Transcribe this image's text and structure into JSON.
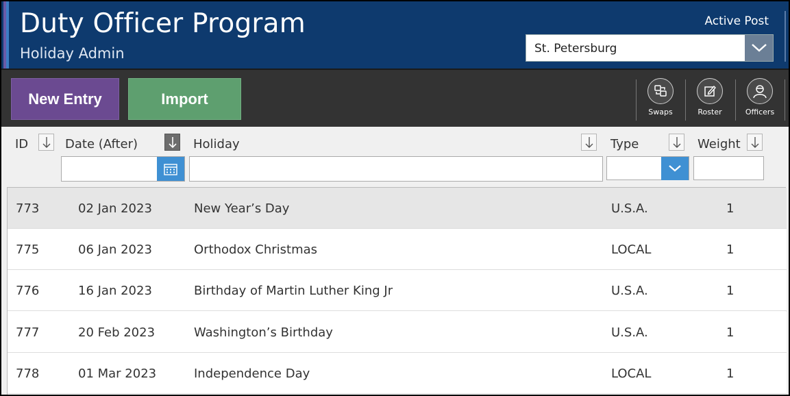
{
  "header": {
    "title": "Duty Officer Program",
    "subtitle": "Holiday Admin",
    "active_post_label": "Active Post",
    "active_post_value": "St. Petersburg"
  },
  "toolbar": {
    "new_entry_label": "New Entry",
    "import_label": "Import",
    "nav": [
      {
        "label": "Swaps",
        "icon": "swap-icon"
      },
      {
        "label": "Roster",
        "icon": "edit-icon"
      },
      {
        "label": "Officers",
        "icon": "officer-icon"
      }
    ]
  },
  "columns": {
    "id": "ID",
    "date": "Date (After)",
    "holiday": "Holiday",
    "type": "Type",
    "weight": "Weight"
  },
  "filters": {
    "date": "",
    "holiday": "",
    "type": "",
    "weight": ""
  },
  "rows": [
    {
      "id": "773",
      "date": "02 Jan 2023",
      "holiday": "New Year’s Day",
      "type": "U.S.A.",
      "weight": "1"
    },
    {
      "id": "775",
      "date": "06 Jan 2023",
      "holiday": "Orthodox Christmas",
      "type": "LOCAL",
      "weight": "1"
    },
    {
      "id": "776",
      "date": "16 Jan 2023",
      "holiday": "Birthday of Martin Luther King Jr",
      "type": "U.S.A.",
      "weight": "1"
    },
    {
      "id": "777",
      "date": "20 Feb 2023",
      "holiday": "Washington’s Birthday",
      "type": "U.S.A.",
      "weight": "1"
    },
    {
      "id": "778",
      "date": "01 Mar 2023",
      "holiday": "Independence Day",
      "type": "LOCAL",
      "weight": "1"
    }
  ],
  "colors": {
    "header_bg": "#0e3a6e",
    "new_entry_bg": "#6b4a91",
    "import_bg": "#5e9f6f",
    "toolbar_bg": "#333333",
    "accent_blue": "#3f90d3"
  }
}
